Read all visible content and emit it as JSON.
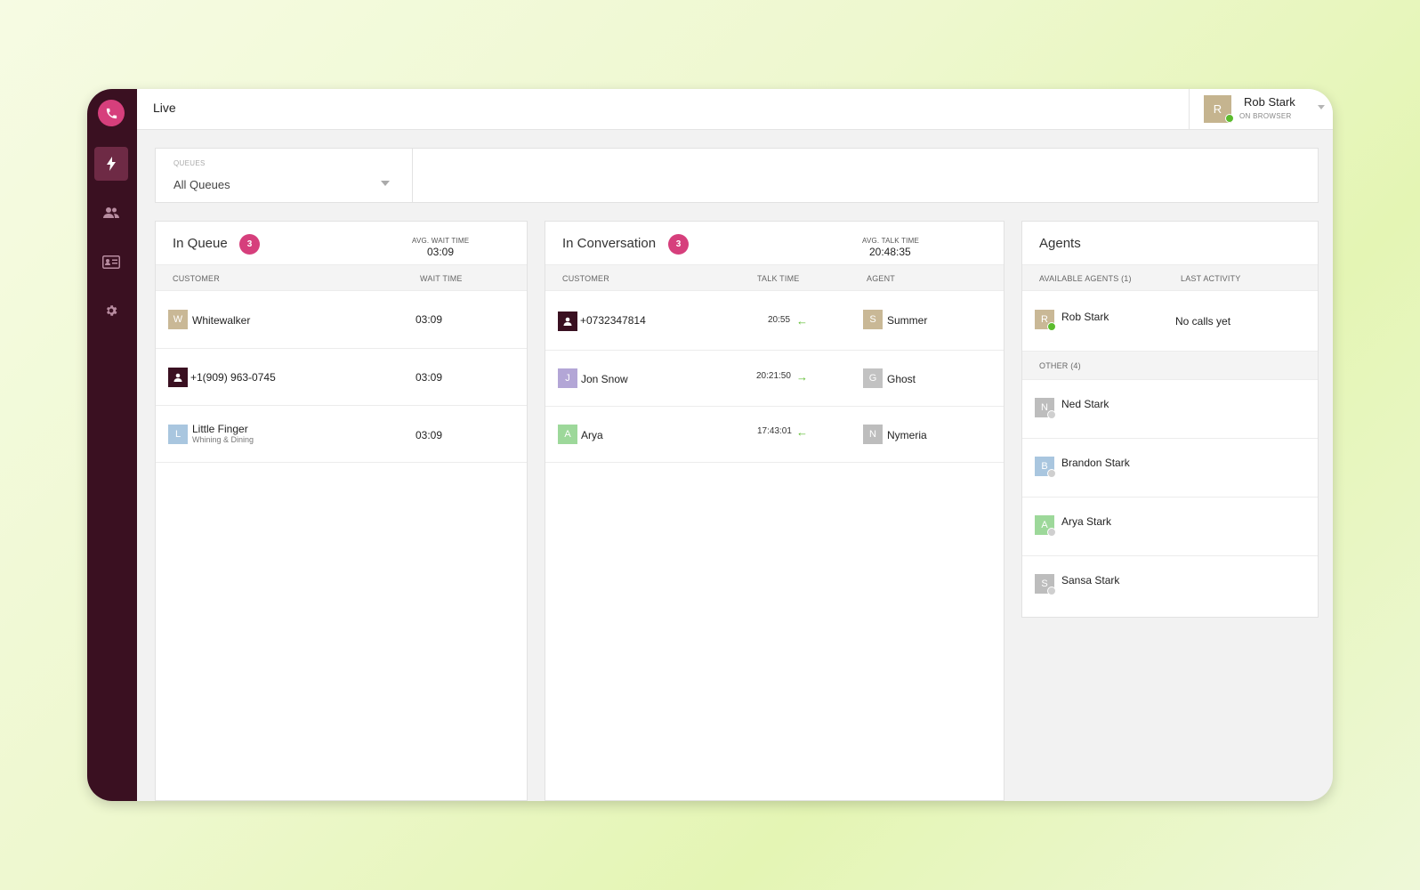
{
  "app": {
    "page_title": "Live",
    "logo_icon": "phone-icon",
    "accent_color": "#d63f7c",
    "sidebar_color": "#3a1021"
  },
  "sidebar": {
    "items": [
      {
        "name": "live",
        "icon": "lightning-icon",
        "active": true
      },
      {
        "name": "agents",
        "icon": "users-icon",
        "active": false
      },
      {
        "name": "contacts",
        "icon": "contact-card-icon",
        "active": false
      },
      {
        "name": "settings",
        "icon": "gear-icon",
        "active": false
      }
    ]
  },
  "user": {
    "initial": "R",
    "name": "Rob Stark",
    "status": "ON BROWSER",
    "status_color": "#5bbb2d"
  },
  "filter": {
    "label": "QUEUES",
    "value": "All Queues"
  },
  "queue_panel": {
    "title": "In Queue",
    "count": "3",
    "stat_label": "AVG. WAIT TIME",
    "stat_value": "03:09",
    "columns": [
      "CUSTOMER",
      "WAIT TIME"
    ],
    "rows": [
      {
        "initial": "W",
        "avatar_color": "#c9b896",
        "name": "Whitewalker",
        "sub": "",
        "wait": "03:09"
      },
      {
        "initial": "",
        "avatar_color": "#3a1021",
        "name": "+1(909) 963-0745",
        "sub": "",
        "wait": "03:09"
      },
      {
        "initial": "L",
        "avatar_color": "#a9c6df",
        "name": "Little Finger",
        "sub": "Whining & Dining",
        "wait": "03:09"
      }
    ]
  },
  "conversation_panel": {
    "title": "In Conversation",
    "count": "3",
    "stat_label": "AVG. TALK TIME",
    "stat_value": "20:48:35",
    "columns": [
      "CUSTOMER",
      "TALK TIME",
      "AGENT"
    ],
    "rows": [
      {
        "initial": "",
        "avatar_color": "#3a1021",
        "name": "+0732347814",
        "time": "20:55",
        "direction": "←",
        "agent_initial": "S",
        "agent_color": "#c9b896",
        "agent": "Summer"
      },
      {
        "initial": "J",
        "avatar_color": "#b3a6d6",
        "name": "Jon Snow",
        "time": "20:21:50",
        "direction": "→",
        "agent_initial": "G",
        "agent_color": "#c2c2c2",
        "agent": "Ghost"
      },
      {
        "initial": "A",
        "avatar_color": "#9dd89a",
        "name": "Arya",
        "time": "17:43:01",
        "direction": "←",
        "agent_initial": "N",
        "agent_color": "#bdbdbd",
        "agent": "Nymeria"
      }
    ]
  },
  "agents_panel": {
    "title": "Agents",
    "available_label": "AVAILABLE AGENTS (1)",
    "last_activity_label": "LAST ACTIVITY",
    "available": [
      {
        "initial": "R",
        "avatar_color": "#c9b896",
        "name": "Rob Stark",
        "activity": "No calls yet",
        "status_color": "#5bbb2d"
      }
    ],
    "other_label": "OTHER (4)",
    "other": [
      {
        "initial": "N",
        "avatar_color": "#bdbdbd",
        "name": "Ned Stark",
        "status_color": "#cfcfcf"
      },
      {
        "initial": "B",
        "avatar_color": "#a9c6df",
        "name": "Brandon Stark",
        "status_color": "#cfcfcf"
      },
      {
        "initial": "A",
        "avatar_color": "#9dd89a",
        "name": "Arya Stark",
        "status_color": "#cfcfcf"
      },
      {
        "initial": "S",
        "avatar_color": "#bdbdbd",
        "name": "Sansa Stark",
        "status_color": "#cfcfcf"
      }
    ]
  }
}
